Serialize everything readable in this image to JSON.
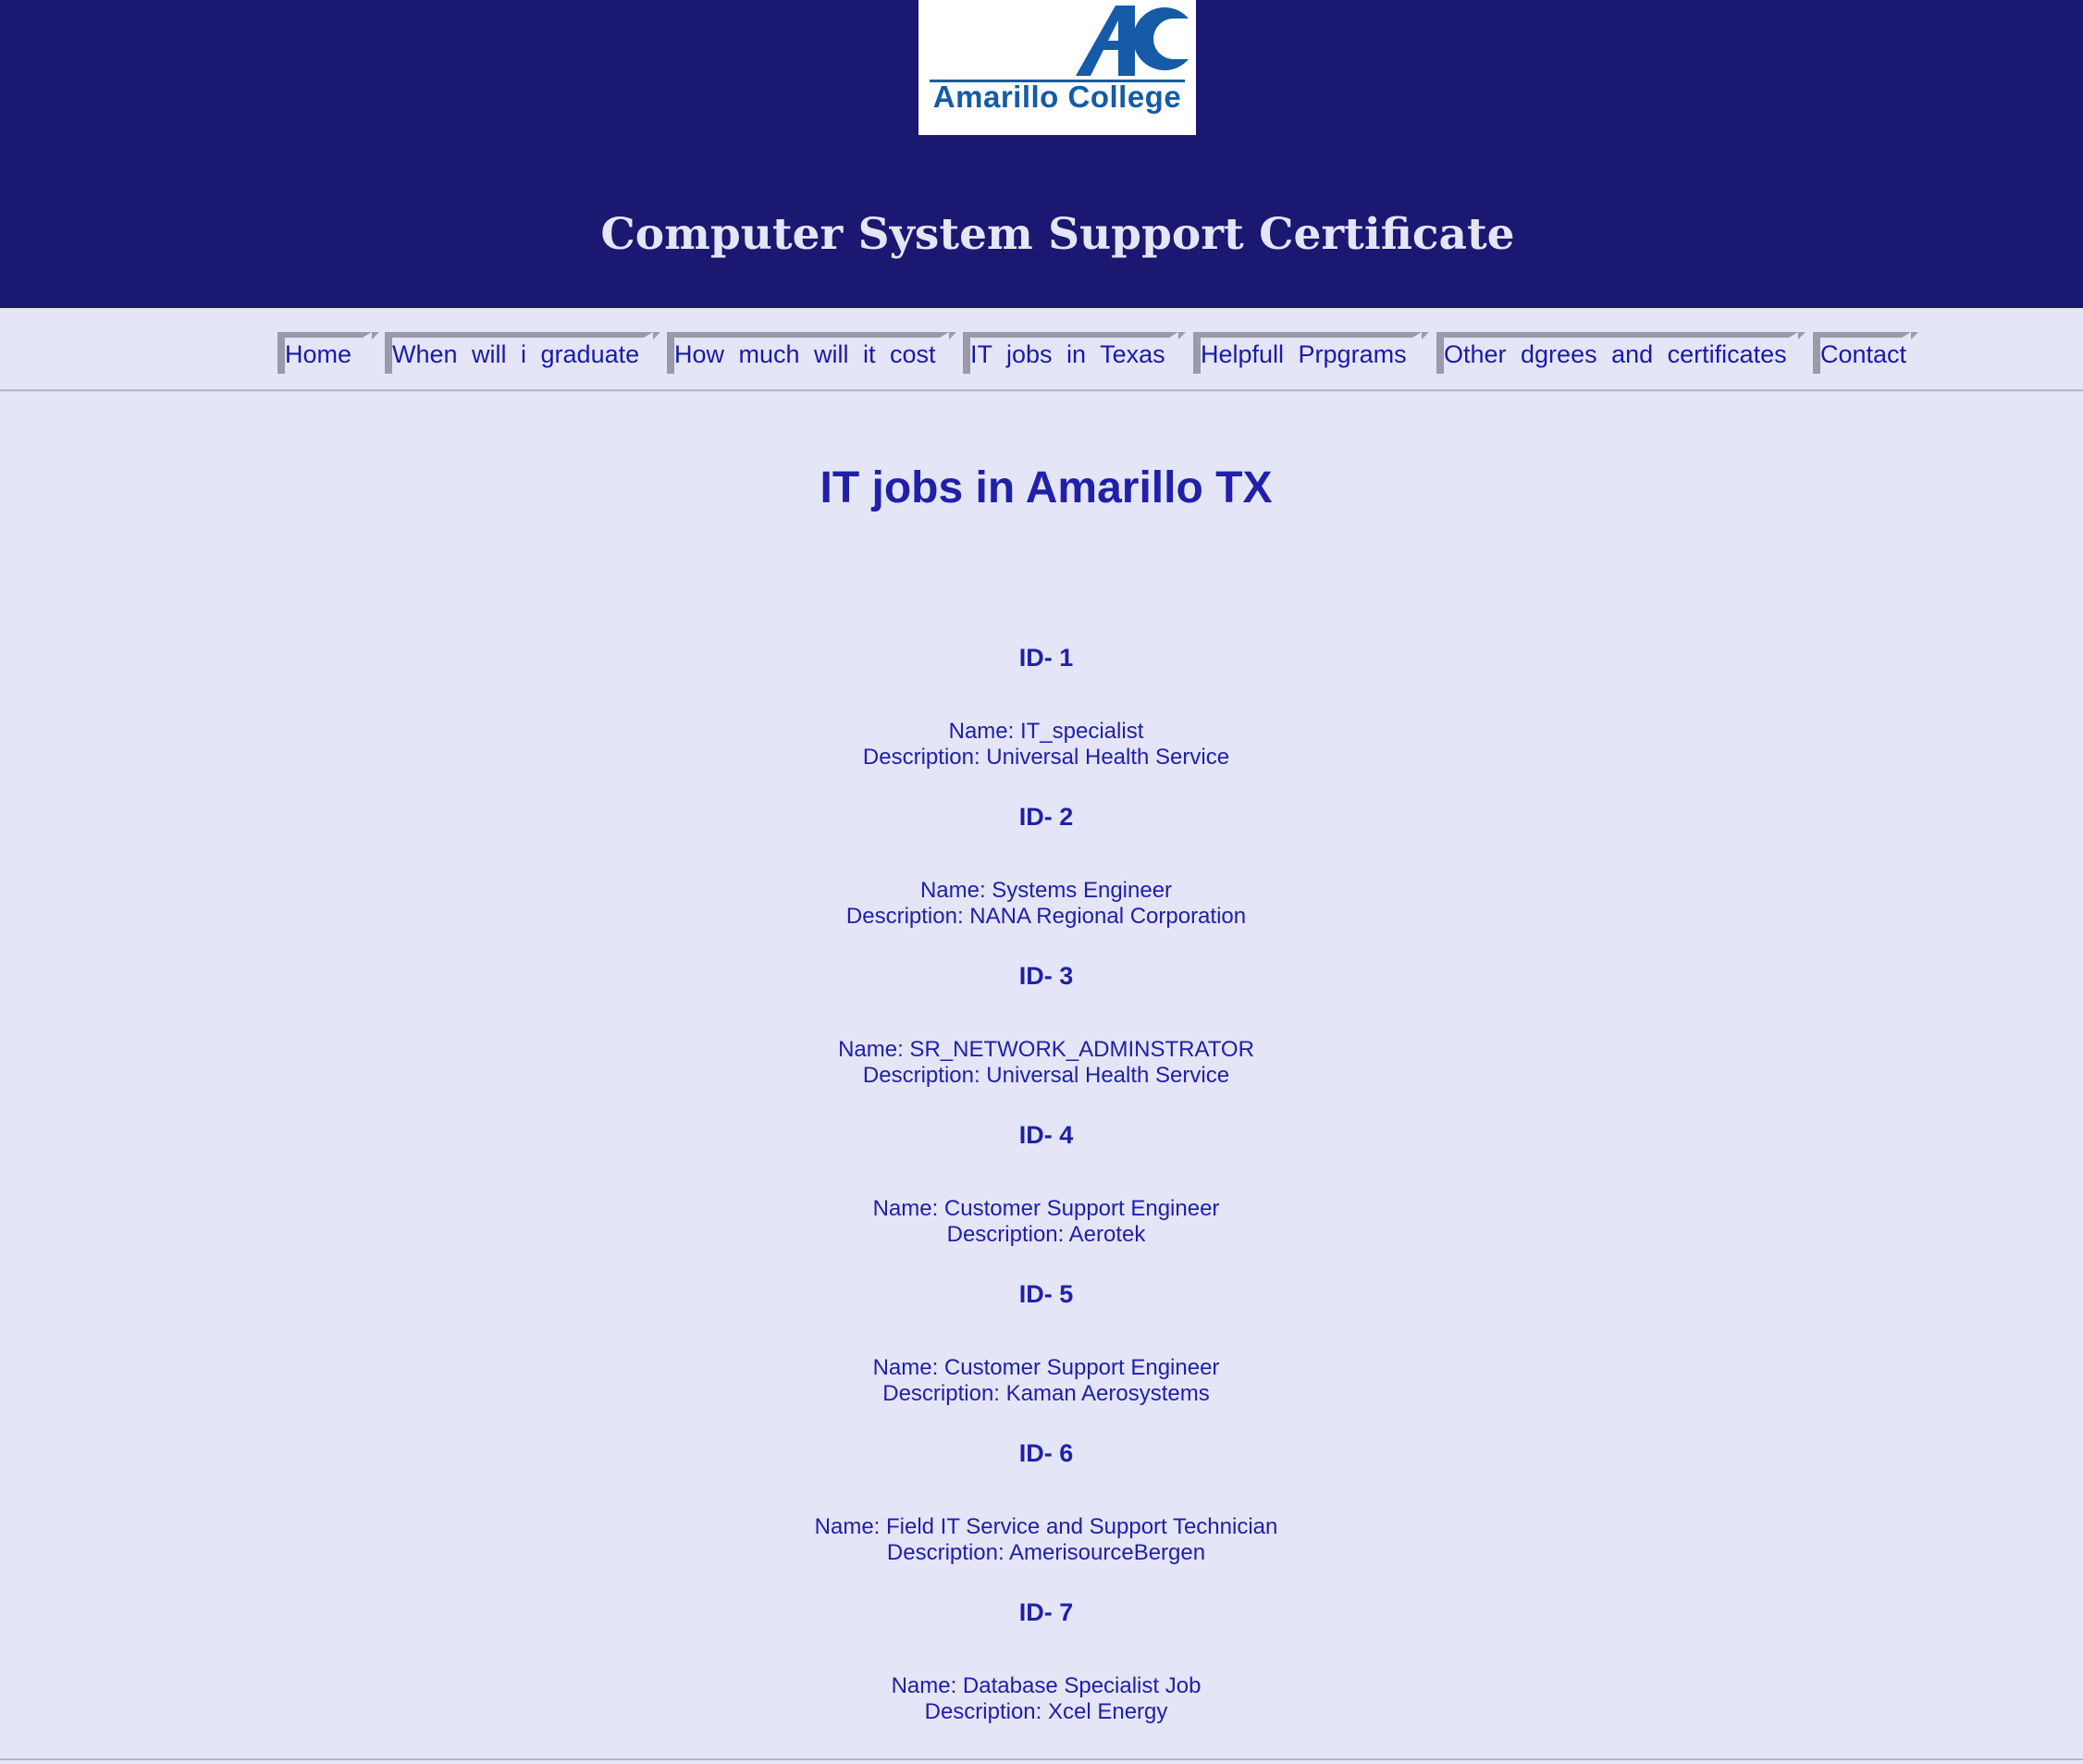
{
  "header": {
    "logo_text": "Amarillo College",
    "logo_mark": "AC",
    "title": "Computer System Support Certificate",
    "colors": {
      "background": "#1a1870",
      "title": "#e4e5f7",
      "logo_blue": "#155ba8"
    }
  },
  "nav": {
    "items": [
      {
        "label": "Home"
      },
      {
        "label": "When will i graduate"
      },
      {
        "label": "How much will it cost"
      },
      {
        "label": "IT jobs in Texas"
      },
      {
        "label": "Helpfull Prpgrams"
      },
      {
        "label": "Other dgrees and certificates"
      },
      {
        "label": "Contact"
      }
    ]
  },
  "main": {
    "heading": "IT jobs in Amarillo TX",
    "jobs": [
      {
        "id": "ID- 1",
        "name": "Name: IT_specialist",
        "description": "Description: Universal Health Service"
      },
      {
        "id": "ID- 2",
        "name": "Name: Systems Engineer",
        "description": "Description: NANA Regional Corporation"
      },
      {
        "id": "ID- 3",
        "name": "Name: SR_NETWORK_ADMINSTRATOR",
        "description": "Description: Universal Health Service"
      },
      {
        "id": "ID- 4",
        "name": "Name: Customer Support Engineer",
        "description": "Description: Aerotek"
      },
      {
        "id": "ID- 5",
        "name": "Name: Customer Support Engineer",
        "description": "Description: Kaman Aerosystems"
      },
      {
        "id": "ID- 6",
        "name": "Name: Field IT Service and Support Technician",
        "description": "Description: AmerisourceBergen"
      },
      {
        "id": "ID- 7",
        "name": "Name: Database Specialist Job",
        "description": "Description: Xcel Energy"
      }
    ],
    "colors": {
      "page_background": "#e4e5f7",
      "text": "#2020aa"
    }
  }
}
